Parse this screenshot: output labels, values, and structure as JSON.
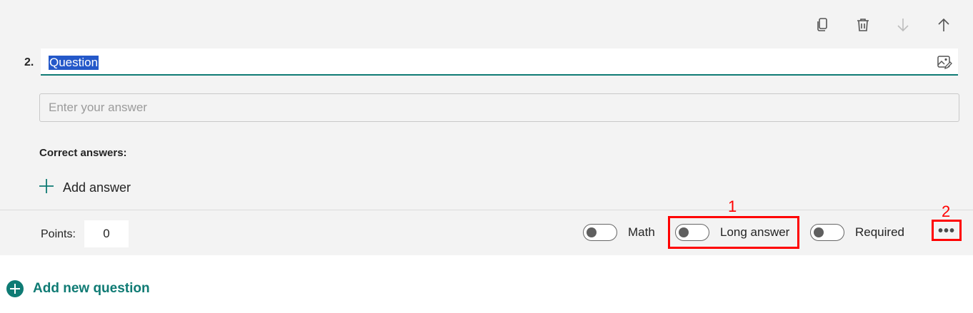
{
  "question": {
    "number": "2.",
    "title": "Question",
    "answer_placeholder": "Enter your answer",
    "correct_answers_label": "Correct answers:",
    "add_answer_label": "Add answer"
  },
  "toolbar": {
    "icons": [
      "copy-icon",
      "delete-icon",
      "move-down-icon",
      "move-up-icon"
    ]
  },
  "footer": {
    "points_label": "Points:",
    "points_value": "0",
    "toggles": [
      {
        "label": "Math",
        "on": false
      },
      {
        "label": "Long answer",
        "on": false
      },
      {
        "label": "Required",
        "on": false
      }
    ],
    "more_label": "•••"
  },
  "annotations": {
    "label_1": "1",
    "label_2": "2",
    "color": "#ff0000"
  },
  "add_new_question_label": "Add new question",
  "colors": {
    "accent": "#0f7b74",
    "card_bg": "#f3f3f3",
    "selection": "#2458c9"
  }
}
